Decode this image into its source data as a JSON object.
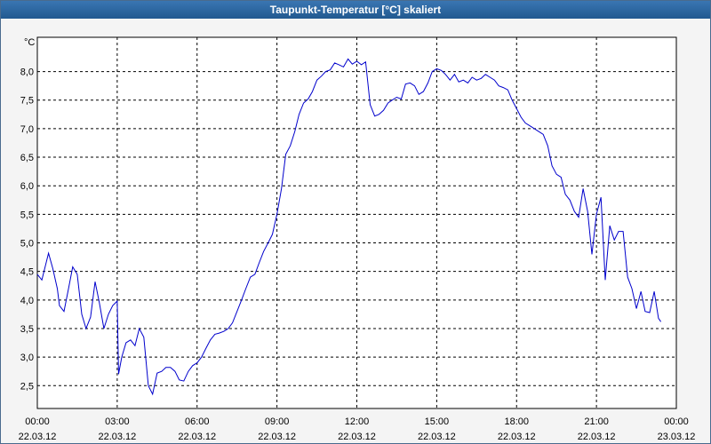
{
  "window": {
    "title": "Taupunkt-Temperatur [°C] skaliert"
  },
  "colors": {
    "titlebar": "#2f68a3",
    "line": "#0000cc",
    "grid": "#000000",
    "background": "#f4f4f4"
  },
  "chart_data": {
    "type": "line",
    "title": "Taupunkt-Temperatur [°C] skaliert",
    "unit_label": "°C",
    "ylim": [
      2.1,
      8.6
    ],
    "xlim_hours": [
      0,
      24
    ],
    "grid": "dashed",
    "y_ticks": [
      {
        "value": 2.5,
        "label": "2,5"
      },
      {
        "value": 3.0,
        "label": "3,0"
      },
      {
        "value": 3.5,
        "label": "3,5"
      },
      {
        "value": 4.0,
        "label": "4,0"
      },
      {
        "value": 4.5,
        "label": "4,5"
      },
      {
        "value": 5.0,
        "label": "5,0"
      },
      {
        "value": 5.5,
        "label": "5,5"
      },
      {
        "value": 6.0,
        "label": "6,0"
      },
      {
        "value": 6.5,
        "label": "6,5"
      },
      {
        "value": 7.0,
        "label": "7,0"
      },
      {
        "value": 7.5,
        "label": "7,5"
      },
      {
        "value": 8.0,
        "label": "8,0"
      }
    ],
    "x_ticks": [
      {
        "hour": 0,
        "time": "00:00",
        "date": "22.03.12"
      },
      {
        "hour": 3,
        "time": "03:00",
        "date": "22.03.12"
      },
      {
        "hour": 6,
        "time": "06:00",
        "date": "22.03.12"
      },
      {
        "hour": 9,
        "time": "09:00",
        "date": "22.03.12"
      },
      {
        "hour": 12,
        "time": "12:00",
        "date": "22.03.12"
      },
      {
        "hour": 15,
        "time": "15:00",
        "date": "22.03.12"
      },
      {
        "hour": 18,
        "time": "18:00",
        "date": "22.03.12"
      },
      {
        "hour": 21,
        "time": "21:00",
        "date": "22.03.12"
      },
      {
        "hour": 24,
        "time": "00:00",
        "date": "23.03.12"
      }
    ],
    "series": [
      {
        "points": [
          [
            0.0,
            4.45
          ],
          [
            0.17,
            4.35
          ],
          [
            0.33,
            4.65
          ],
          [
            0.42,
            4.82
          ],
          [
            0.58,
            4.55
          ],
          [
            0.75,
            4.2
          ],
          [
            0.83,
            3.9
          ],
          [
            1.0,
            3.8
          ],
          [
            1.17,
            4.2
          ],
          [
            1.33,
            4.58
          ],
          [
            1.5,
            4.45
          ],
          [
            1.67,
            3.75
          ],
          [
            1.83,
            3.5
          ],
          [
            2.0,
            3.7
          ],
          [
            2.17,
            4.32
          ],
          [
            2.33,
            3.95
          ],
          [
            2.5,
            3.5
          ],
          [
            2.67,
            3.75
          ],
          [
            2.83,
            3.9
          ],
          [
            3.0,
            3.98
          ],
          [
            3.05,
            2.7
          ],
          [
            3.17,
            3.0
          ],
          [
            3.33,
            3.25
          ],
          [
            3.5,
            3.3
          ],
          [
            3.67,
            3.2
          ],
          [
            3.83,
            3.5
          ],
          [
            4.0,
            3.35
          ],
          [
            4.17,
            2.5
          ],
          [
            4.33,
            2.35
          ],
          [
            4.5,
            2.72
          ],
          [
            4.67,
            2.75
          ],
          [
            4.83,
            2.82
          ],
          [
            5.0,
            2.82
          ],
          [
            5.17,
            2.75
          ],
          [
            5.33,
            2.6
          ],
          [
            5.5,
            2.58
          ],
          [
            5.67,
            2.75
          ],
          [
            5.83,
            2.85
          ],
          [
            6.0,
            2.9
          ],
          [
            6.17,
            3.0
          ],
          [
            6.33,
            3.15
          ],
          [
            6.5,
            3.3
          ],
          [
            6.67,
            3.4
          ],
          [
            6.83,
            3.42
          ],
          [
            7.0,
            3.45
          ],
          [
            7.17,
            3.5
          ],
          [
            7.33,
            3.6
          ],
          [
            7.5,
            3.8
          ],
          [
            7.67,
            4.0
          ],
          [
            7.83,
            4.2
          ],
          [
            8.0,
            4.4
          ],
          [
            8.17,
            4.45
          ],
          [
            8.33,
            4.65
          ],
          [
            8.5,
            4.85
          ],
          [
            8.67,
            5.0
          ],
          [
            8.83,
            5.15
          ],
          [
            9.0,
            5.5
          ],
          [
            9.17,
            5.95
          ],
          [
            9.33,
            6.55
          ],
          [
            9.5,
            6.7
          ],
          [
            9.67,
            6.95
          ],
          [
            9.83,
            7.25
          ],
          [
            10.0,
            7.45
          ],
          [
            10.17,
            7.52
          ],
          [
            10.33,
            7.65
          ],
          [
            10.5,
            7.85
          ],
          [
            10.67,
            7.92
          ],
          [
            10.83,
            8.0
          ],
          [
            11.0,
            8.03
          ],
          [
            11.17,
            8.15
          ],
          [
            11.33,
            8.12
          ],
          [
            11.5,
            8.08
          ],
          [
            11.67,
            8.22
          ],
          [
            11.83,
            8.13
          ],
          [
            12.0,
            8.18
          ],
          [
            12.17,
            8.12
          ],
          [
            12.33,
            8.17
          ],
          [
            12.5,
            7.42
          ],
          [
            12.67,
            7.22
          ],
          [
            12.83,
            7.25
          ],
          [
            13.0,
            7.32
          ],
          [
            13.17,
            7.45
          ],
          [
            13.33,
            7.5
          ],
          [
            13.5,
            7.55
          ],
          [
            13.67,
            7.52
          ],
          [
            13.83,
            7.78
          ],
          [
            14.0,
            7.8
          ],
          [
            14.17,
            7.75
          ],
          [
            14.33,
            7.6
          ],
          [
            14.5,
            7.65
          ],
          [
            14.67,
            7.8
          ],
          [
            14.83,
            8.0
          ],
          [
            15.0,
            8.05
          ],
          [
            15.17,
            8.02
          ],
          [
            15.33,
            7.95
          ],
          [
            15.5,
            7.85
          ],
          [
            15.67,
            7.95
          ],
          [
            15.83,
            7.82
          ],
          [
            16.0,
            7.85
          ],
          [
            16.17,
            7.8
          ],
          [
            16.33,
            7.9
          ],
          [
            16.5,
            7.85
          ],
          [
            16.67,
            7.88
          ],
          [
            16.83,
            7.95
          ],
          [
            17.0,
            7.9
          ],
          [
            17.17,
            7.85
          ],
          [
            17.33,
            7.75
          ],
          [
            17.5,
            7.72
          ],
          [
            17.67,
            7.68
          ],
          [
            17.83,
            7.5
          ],
          [
            18.0,
            7.35
          ],
          [
            18.17,
            7.2
          ],
          [
            18.33,
            7.1
          ],
          [
            18.5,
            7.05
          ],
          [
            18.67,
            7.0
          ],
          [
            18.83,
            6.95
          ],
          [
            19.0,
            6.9
          ],
          [
            19.17,
            6.7
          ],
          [
            19.33,
            6.35
          ],
          [
            19.5,
            6.2
          ],
          [
            19.67,
            6.15
          ],
          [
            19.83,
            5.85
          ],
          [
            20.0,
            5.75
          ],
          [
            20.17,
            5.55
          ],
          [
            20.33,
            5.45
          ],
          [
            20.5,
            5.95
          ],
          [
            20.67,
            5.55
          ],
          [
            20.83,
            4.8
          ],
          [
            21.0,
            5.5
          ],
          [
            21.17,
            5.8
          ],
          [
            21.33,
            4.35
          ],
          [
            21.5,
            5.3
          ],
          [
            21.67,
            5.05
          ],
          [
            21.83,
            5.2
          ],
          [
            22.0,
            5.2
          ],
          [
            22.17,
            4.4
          ],
          [
            22.33,
            4.2
          ],
          [
            22.5,
            3.85
          ],
          [
            22.67,
            4.15
          ],
          [
            22.83,
            3.8
          ],
          [
            23.0,
            3.78
          ],
          [
            23.17,
            4.15
          ],
          [
            23.33,
            3.68
          ],
          [
            23.42,
            3.62
          ]
        ]
      }
    ]
  }
}
